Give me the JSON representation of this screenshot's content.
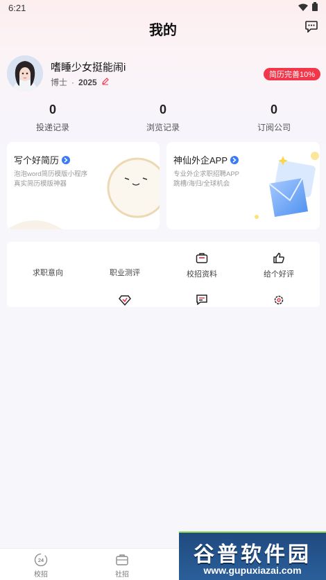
{
  "status_bar": {
    "time": "6:21"
  },
  "header": {
    "title": "我的"
  },
  "profile": {
    "name": "嗜睡少女挺能闹i",
    "degree": "博士",
    "separator": "·",
    "year": "2025",
    "resume_badge": "简历完善10%"
  },
  "stats": [
    {
      "count": "0",
      "label": "投递记录"
    },
    {
      "count": "0",
      "label": "浏览记录"
    },
    {
      "count": "0",
      "label": "订阅公司"
    }
  ],
  "cards": [
    {
      "title": "写个好简历",
      "desc1": "泡泡word简历模版小程序",
      "desc2": "真实简历模版神器"
    },
    {
      "title": "神仙外企APP",
      "desc1": "专业外企求职招聘APP",
      "desc2": "跳槽/海归/全球机会"
    }
  ],
  "tools": [
    {
      "label": "求职意向"
    },
    {
      "label": "职业测评"
    },
    {
      "label": "校招资料"
    },
    {
      "label": "给个好评"
    }
  ],
  "tabbar": [
    {
      "label": "校招",
      "icon_text": "24"
    },
    {
      "label": "社招"
    }
  ],
  "watermark": {
    "title": "谷普软件园",
    "url": "www.gupuxiazai.com"
  },
  "colors": {
    "accent_red": "#f2374a",
    "accent_blue": "#3a7bf5"
  }
}
